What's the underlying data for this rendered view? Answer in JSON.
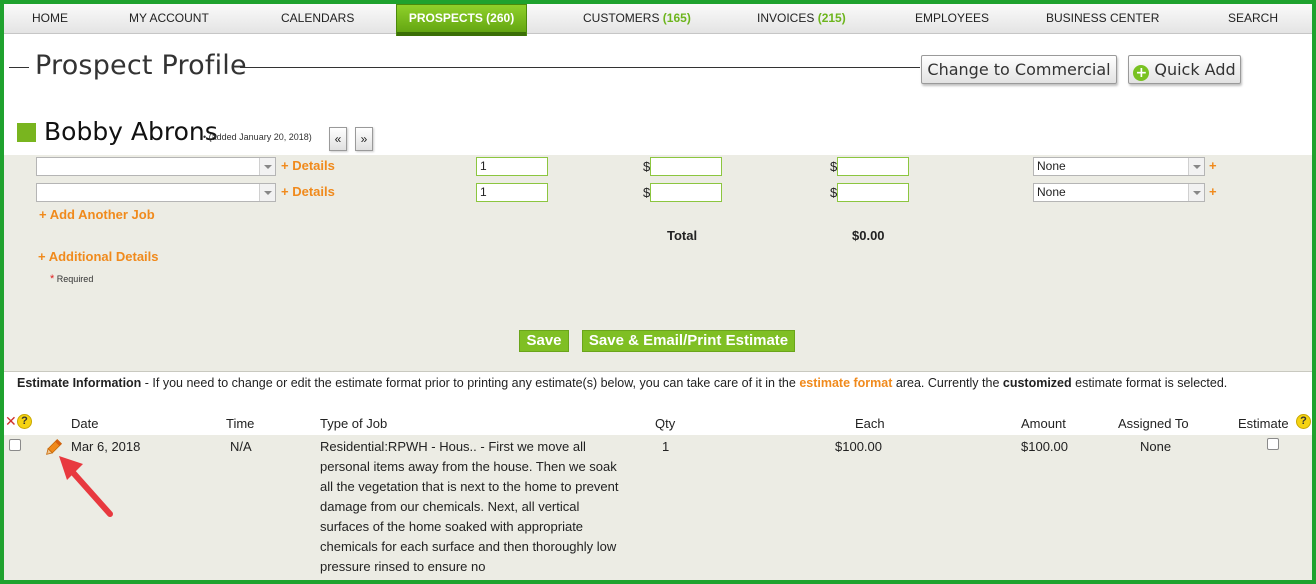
{
  "nav": {
    "items": [
      {
        "label": "HOME",
        "count": ""
      },
      {
        "label": "MY ACCOUNT",
        "count": ""
      },
      {
        "label": "CALENDARS",
        "count": ""
      },
      {
        "label": "PROSPECTS",
        "count": "(260)"
      },
      {
        "label": "CUSTOMERS",
        "count": "(165)"
      },
      {
        "label": "INVOICES",
        "count": "(215)"
      },
      {
        "label": "EMPLOYEES",
        "count": ""
      },
      {
        "label": "BUSINESS CENTER",
        "count": ""
      },
      {
        "label": "SEARCH",
        "count": ""
      }
    ],
    "active_index": 3
  },
  "header": {
    "title": "Prospect Profile",
    "change_button": "Change to Commercial",
    "quick_add_button": "Quick Add"
  },
  "prospect": {
    "name": "Bobby Abrons",
    "added_note": "• (added January 20, 2018)",
    "prev_icon": "«",
    "next_icon": "»"
  },
  "jobs": {
    "rows": [
      {
        "job": "",
        "details_link": "+ Details",
        "qty": "1",
        "each_symbol": "$",
        "each": "",
        "amount_symbol": "$",
        "amount": "",
        "assigned": "None",
        "plus": "+"
      },
      {
        "job": "",
        "details_link": "+ Details",
        "qty": "1",
        "each_symbol": "$",
        "each": "",
        "amount_symbol": "$",
        "amount": "",
        "assigned": "None",
        "plus": "+"
      }
    ],
    "add_another_job": "+ Add Another Job",
    "total_label": "Total",
    "total_value": "$0.00",
    "additional_details": "+ Additional Details",
    "required_star": "*",
    "required_note": "Required",
    "save_button": "Save",
    "save_email_button": "Save & Email/Print Estimate"
  },
  "estimate_info": {
    "label": "Estimate Information",
    "text1": " - If you need to change or edit the estimate format prior to printing any estimate(s) below, you can take care of it in the ",
    "link": "estimate format",
    "text2": " area. Currently the ",
    "format_name": "customized",
    "text3": " estimate format is selected."
  },
  "table": {
    "help_glyph": "?",
    "headers": {
      "date": "Date",
      "time": "Time",
      "type": "Type of Job",
      "qty": "Qty",
      "each": "Each",
      "amount": "Amount",
      "assigned": "Assigned To",
      "estimate": "Estimate"
    },
    "rows": [
      {
        "date": "Mar 6, 2018",
        "time": "N/A",
        "type": "Residential:RPWH - Hous.. - First we move all personal items away from the house. Then we soak all the vegetation that is next to the home to prevent damage from our chemicals. Next, all vertical surfaces of the home soaked with appropriate chemicals for each surface and then thoroughly low pressure rinsed to ensure no",
        "qty": "1",
        "each": "$100.00",
        "amount": "$100.00",
        "assigned": "None"
      }
    ]
  },
  "colors": {
    "accent_green": "#79b51f",
    "link_orange": "#f08a1c",
    "frame_green": "#1fa22e",
    "annotation_red": "#e8393f"
  }
}
